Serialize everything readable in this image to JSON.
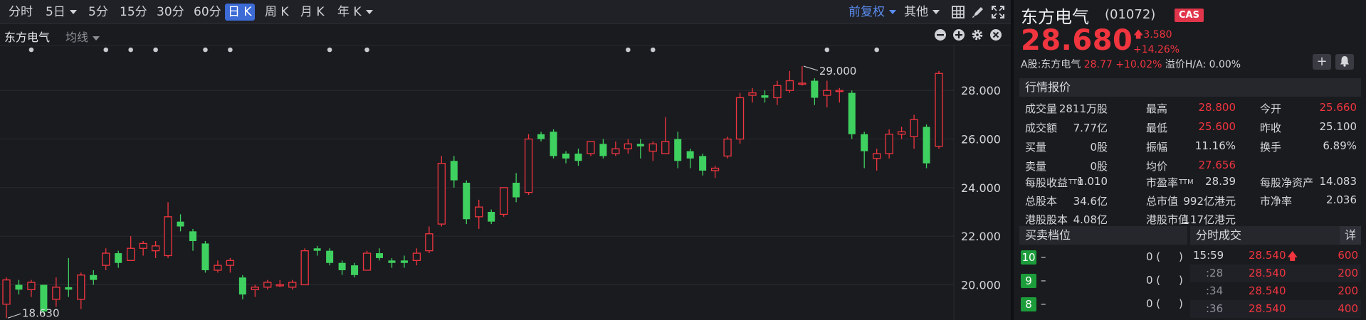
{
  "toolbar": {
    "periods": [
      "分时",
      "5日",
      "5分",
      "15分",
      "30分",
      "60分",
      "日 K",
      "周 K",
      "月 K",
      "年 K"
    ],
    "adjust": "前复权",
    "other": "其他"
  },
  "subbar": {
    "name": "东方电气",
    "ma": "均线"
  },
  "chart_data": {
    "type": "candlestick",
    "y_ticks": [
      "28.000",
      "26.000",
      "24.000",
      "22.000",
      "20.000"
    ],
    "y_values": [
      28,
      26,
      24,
      22,
      20
    ],
    "ylim": [
      18.55,
      29.85
    ],
    "annotations": {
      "high_label": "29.000",
      "high_value": 29.0,
      "low_label": "18.630",
      "low_value": 18.63
    },
    "candles": [
      [
        19.2,
        20.2,
        20.3,
        18.63
      ],
      [
        20.0,
        19.8,
        20.2,
        19.6
      ],
      [
        19.8,
        20.1,
        20.2,
        19.5
      ],
      [
        20.0,
        18.9,
        20.0,
        18.8
      ],
      [
        19.4,
        19.9,
        20.3,
        19.1
      ],
      [
        19.9,
        19.8,
        21.1,
        19.5
      ],
      [
        19.4,
        20.4,
        20.5,
        19.0
      ],
      [
        20.4,
        20.2,
        20.6,
        20.0
      ],
      [
        20.8,
        21.3,
        21.5,
        20.6
      ],
      [
        21.3,
        20.9,
        21.4,
        20.7
      ],
      [
        21.0,
        21.5,
        22.0,
        21.0
      ],
      [
        21.5,
        21.7,
        21.8,
        21.2
      ],
      [
        21.4,
        21.6,
        21.8,
        21.1
      ],
      [
        21.2,
        22.8,
        23.4,
        21.1
      ],
      [
        22.6,
        22.4,
        22.9,
        22.2
      ],
      [
        22.2,
        21.8,
        22.3,
        21.4
      ],
      [
        21.7,
        20.6,
        21.8,
        20.5
      ],
      [
        20.6,
        20.8,
        21.0,
        20.5
      ],
      [
        20.8,
        21.0,
        21.1,
        20.5
      ],
      [
        20.3,
        19.6,
        20.4,
        19.4
      ],
      [
        19.8,
        19.9,
        20.0,
        19.5
      ],
      [
        19.9,
        20.1,
        20.2,
        19.8
      ],
      [
        20.0,
        20.0,
        20.2,
        19.9
      ],
      [
        19.9,
        20.1,
        20.2,
        19.8
      ],
      [
        20.0,
        21.4,
        21.5,
        20.0
      ],
      [
        21.5,
        21.4,
        21.6,
        21.2
      ],
      [
        21.4,
        20.9,
        21.5,
        20.8
      ],
      [
        20.9,
        20.6,
        21.0,
        20.4
      ],
      [
        20.8,
        20.4,
        20.9,
        20.3
      ],
      [
        20.6,
        21.3,
        21.4,
        20.6
      ],
      [
        21.3,
        21.1,
        21.5,
        21.0
      ],
      [
        21.0,
        20.9,
        21.1,
        20.7
      ],
      [
        21.0,
        20.9,
        21.2,
        20.7
      ],
      [
        21.0,
        21.3,
        21.5,
        20.8
      ],
      [
        21.4,
        22.1,
        22.4,
        21.3
      ],
      [
        22.5,
        25.0,
        25.3,
        22.4
      ],
      [
        25.1,
        24.3,
        25.3,
        24.0
      ],
      [
        24.2,
        22.7,
        24.3,
        22.5
      ],
      [
        22.8,
        23.2,
        23.5,
        22.3
      ],
      [
        23.0,
        22.6,
        23.1,
        22.5
      ],
      [
        22.9,
        24.0,
        24.0,
        22.8
      ],
      [
        24.2,
        23.6,
        24.6,
        23.4
      ],
      [
        23.8,
        26.0,
        26.2,
        23.7
      ],
      [
        26.2,
        26.0,
        26.3,
        25.9
      ],
      [
        26.3,
        25.3,
        26.4,
        25.2
      ],
      [
        25.4,
        25.2,
        25.5,
        25.0
      ],
      [
        25.4,
        25.1,
        25.6,
        24.9
      ],
      [
        25.4,
        25.9,
        25.9,
        25.3
      ],
      [
        25.8,
        25.3,
        26.0,
        25.2
      ],
      [
        25.4,
        25.6,
        25.9,
        25.3
      ],
      [
        25.6,
        25.8,
        26.0,
        25.4
      ],
      [
        25.8,
        25.7,
        26.0,
        25.2
      ],
      [
        25.5,
        25.8,
        25.9,
        25.1
      ],
      [
        25.4,
        25.9,
        26.9,
        25.4
      ],
      [
        26.0,
        25.1,
        26.3,
        24.8
      ],
      [
        25.5,
        25.2,
        25.6,
        24.8
      ],
      [
        25.3,
        24.7,
        25.4,
        24.5
      ],
      [
        24.7,
        24.8,
        24.9,
        24.4
      ],
      [
        25.3,
        26.0,
        26.1,
        25.2
      ],
      [
        26.0,
        27.7,
        27.9,
        25.8
      ],
      [
        27.8,
        27.9,
        28.1,
        27.5
      ],
      [
        27.8,
        27.7,
        28.0,
        27.5
      ],
      [
        27.7,
        28.2,
        28.4,
        27.4
      ],
      [
        28.0,
        28.4,
        28.8,
        27.9
      ],
      [
        28.3,
        28.3,
        29.0,
        28.2
      ],
      [
        28.4,
        27.7,
        28.5,
        27.4
      ],
      [
        27.8,
        28.0,
        28.4,
        27.3
      ],
      [
        28.0,
        28.0,
        28.1,
        27.5
      ],
      [
        27.9,
        26.2,
        28.0,
        26.0
      ],
      [
        26.2,
        25.5,
        26.3,
        24.8
      ],
      [
        25.2,
        25.4,
        25.6,
        24.7
      ],
      [
        25.4,
        26.2,
        26.4,
        25.2
      ],
      [
        26.2,
        26.3,
        26.5,
        26.0
      ],
      [
        26.1,
        26.8,
        27.0,
        25.6
      ],
      [
        26.5,
        25.0,
        26.6,
        24.8
      ],
      [
        25.7,
        28.7,
        28.8,
        25.6
      ]
    ]
  },
  "stock": {
    "name": "东方电气",
    "code": "(01072)",
    "badge": "CAS",
    "price": "28.680",
    "change": "3.580",
    "change_pct": "+14.26%",
    "a_share_label": "A股:东方电气",
    "a_share_price": "28.77",
    "a_share_pct": "+10.02%",
    "premium": "溢价H/A: 0.00%"
  },
  "quote_header": "行情报价",
  "quotes": [
    {
      "l1": "成交量",
      "v1": "2811万股",
      "l2": "最高",
      "v2": "28.800",
      "l3": "今开",
      "v3": "25.660"
    },
    {
      "l1": "成交额",
      "v1": "7.77亿",
      "l2": "最低",
      "v2": "25.600",
      "l3": "昨收",
      "v3": "25.100"
    },
    {
      "l1": "买量",
      "v1": "0股",
      "l2": "振幅",
      "v2": "11.16%",
      "l3": "换手",
      "v3": "6.89%"
    },
    {
      "l1": "卖量",
      "v1": "0股",
      "l2": "均价",
      "v2": "27.656",
      "l3": "",
      "v3": ""
    }
  ],
  "fundamentals": [
    {
      "l1": "每股收益",
      "t1": "TTM",
      "v1": "1.010",
      "l2": "市盈率",
      "t2": "TTM",
      "v2": "28.39",
      "l3": "每股净资产",
      "v3": "14.083"
    },
    {
      "l1": "总股本",
      "t1": "",
      "v1": "34.6亿",
      "l2": "总市值",
      "t2": "",
      "v2": "992亿港元",
      "l3": "市净率",
      "v3": "2.036"
    },
    {
      "l1": "港股股本",
      "t1": "",
      "v1": "4.08亿",
      "l2": "港股市值",
      "t2": "",
      "v2": "117亿港元",
      "l3": "",
      "v3": ""
    }
  ],
  "orderbook_header": "买卖档位",
  "orderbook": [
    {
      "level": "10",
      "price": "–",
      "qty": "0 (",
      "close": ")"
    },
    {
      "level": "9",
      "price": "–",
      "qty": "0 (",
      "close": ")"
    },
    {
      "level": "8",
      "price": "–",
      "qty": "0 (",
      "close": ")"
    }
  ],
  "trades_header": "分时成交",
  "trades_detail": "详",
  "trades": [
    {
      "time": "15:59",
      "price": "28.540",
      "vol": "600"
    },
    {
      "time": ":28",
      "price": "28.540",
      "vol": "200"
    },
    {
      "time": ":34",
      "price": "28.540",
      "vol": "200"
    },
    {
      "time": ":36",
      "price": "28.540",
      "vol": "400"
    }
  ],
  "colors": {
    "up": "#f0353f",
    "down": "#3fd160",
    "accent": "#3c6bd6",
    "grid": "#2a2b31",
    "level_bg": "#1c9c3a"
  }
}
